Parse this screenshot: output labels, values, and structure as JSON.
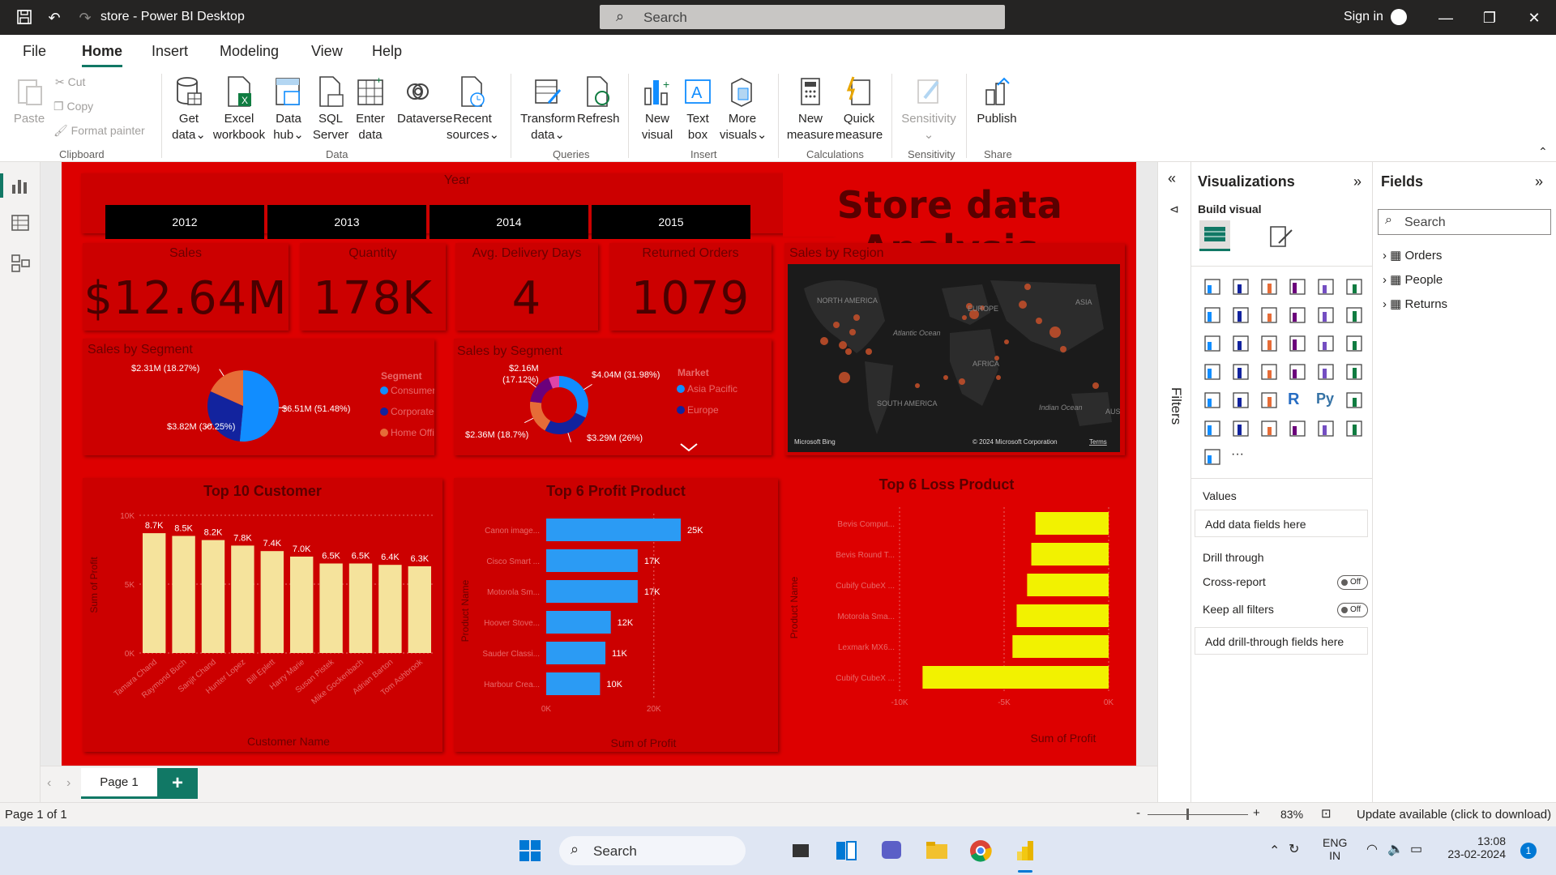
{
  "app": {
    "title": "store - Power BI Desktop",
    "search_placeholder": "Search",
    "signin": "Sign in"
  },
  "menu": {
    "tabs": [
      "File",
      "Home",
      "Insert",
      "Modeling",
      "View",
      "Help"
    ],
    "active": "Home"
  },
  "ribbon": {
    "paste": "Paste",
    "cut": "Cut",
    "copy": "Copy",
    "format_painter": "Format painter",
    "get_data": "Get data",
    "excel": "Excel workbook",
    "data_hub": "Data hub",
    "sql": "SQL Server",
    "enter_data": "Enter data",
    "dataverse": "Dataverse",
    "recent": "Recent sources",
    "transform": "Transform data",
    "refresh": "Refresh",
    "new_visual": "New visual",
    "text_box": "Text box",
    "more_visuals": "More visuals",
    "new_measure": "New measure",
    "quick_measure": "Quick measure",
    "sensitivity": "Sensitivity",
    "publish": "Publish",
    "groups": {
      "clipboard": "Clipboard",
      "data": "Data",
      "queries": "Queries",
      "insert": "Insert",
      "calculations": "Calculations",
      "sensitivity": "Sensitivity",
      "share": "Share"
    }
  },
  "report": {
    "year_slicer": {
      "title": "Year",
      "years": [
        "2012",
        "2013",
        "2014",
        "2015"
      ]
    },
    "main_title": "Store data Analysis",
    "kpis": [
      {
        "title": "Sales",
        "value": "$12.64M"
      },
      {
        "title": "Quantity",
        "value": "178K"
      },
      {
        "title": "Avg. Delivery Days",
        "value": "4"
      },
      {
        "title": "Returned Orders",
        "value": "1079"
      }
    ],
    "map": {
      "title": "Sales by Region",
      "credit": "Microsoft Bing",
      "copyright": "© 2024 Microsoft Corporation",
      "terms": "Terms",
      "labels": [
        "NORTH AMERICA",
        "EUROPE",
        "ASIA",
        "Atlantic Ocean",
        "AFRICA",
        "SOUTH AMERICA",
        "Indian Ocean",
        "AUST"
      ]
    }
  },
  "chart_data": [
    {
      "type": "pie",
      "title": "Sales by Segment",
      "legend_title": "Segment",
      "categories": [
        "Consumer",
        "Corporate",
        "Home Office"
      ],
      "values": [
        6.51,
        3.82,
        2.31
      ],
      "labels": [
        "$6.51M (51.48%)",
        "$3.82M (30.25%)",
        "$2.31M (18.27%)"
      ],
      "colors": [
        "#118dff",
        "#12239e",
        "#e66c37"
      ]
    },
    {
      "type": "pie",
      "title": "Sales by Segment",
      "legend_title": "Market",
      "categories": [
        "Asia Pacific",
        "Europe"
      ],
      "values": [
        4.04,
        3.29,
        2.36,
        2.16,
        0.75
      ],
      "labels": [
        "$4.04M (31.98%)",
        "$3.29M (26%)",
        "$2.36M (18.7%)",
        "$2.16M (17.12%)",
        ""
      ],
      "colors": [
        "#118dff",
        "#12239e",
        "#e66c37",
        "#6b007b",
        "#e044a7"
      ]
    },
    {
      "type": "bar",
      "title": "Top 10 Customer",
      "xlabel": "Customer Name",
      "ylabel": "Sum of Profit",
      "categories": [
        "Tamara Chand",
        "Raymond Buch",
        "Sanjit Chand",
        "Hunter Lopez",
        "Bill Eplett",
        "Harry Marie",
        "Susan Pistek",
        "Mike Gockenbach",
        "Adrian Barton",
        "Tom Ashbrook"
      ],
      "values": [
        8700,
        8500,
        8200,
        7800,
        7400,
        7000,
        6500,
        6500,
        6400,
        6300
      ],
      "data_labels": [
        "8.7K",
        "8.5K",
        "8.2K",
        "7.8K",
        "7.4K",
        "7.0K",
        "6.5K",
        "6.5K",
        "6.4K",
        "6.3K"
      ],
      "ylim": [
        0,
        10000
      ],
      "yticks": [
        "0K",
        "5K",
        "10K"
      ],
      "color": "#f5e39c"
    },
    {
      "type": "bar",
      "orientation": "horizontal",
      "title": "Top 6 Profit Product",
      "xlabel": "Sum of Profit",
      "ylabel": "Product Name",
      "categories": [
        "Canon image...",
        "Cisco Smart ...",
        "Motorola Sm...",
        "Hoover Stove...",
        "Sauder Classi...",
        "Harbour Crea..."
      ],
      "values": [
        25000,
        17000,
        17000,
        12000,
        11000,
        10000
      ],
      "data_labels": [
        "25K",
        "17K",
        "17K",
        "12K",
        "11K",
        "10K"
      ],
      "xlim": [
        0,
        25000
      ],
      "xticks": [
        "0K",
        "20K"
      ],
      "color": "#2b9bf4"
    },
    {
      "type": "bar",
      "orientation": "horizontal",
      "title": "Top 6 Loss Product",
      "xlabel": "Sum of Profit",
      "ylabel": "Product Name",
      "categories": [
        "Bevis Comput...",
        "Bevis Round T...",
        "Cubify CubeX ...",
        "Motorola Sma...",
        "Lexmark MX6...",
        "Cubify CubeX ..."
      ],
      "values": [
        -3500,
        -3700,
        -3900,
        -4400,
        -4600,
        -8900
      ],
      "xlim": [
        -10000,
        0
      ],
      "xticks": [
        "-10K",
        "-5K",
        "0K"
      ],
      "color": "#f2f200"
    }
  ],
  "filters_label": "Filters",
  "viz_pane": {
    "title": "Visualizations",
    "build_visual": "Build visual",
    "values": "Values",
    "add_data": "Add data fields here",
    "drill_through": "Drill through",
    "cross_report": "Cross-report",
    "keep_filters": "Keep all filters",
    "toggle_off": "Off",
    "add_drill": "Add drill-through fields here"
  },
  "fields_pane": {
    "title": "Fields",
    "search": "Search",
    "tables": [
      "Orders",
      "People",
      "Returns"
    ]
  },
  "page_tabs": {
    "page1": "Page 1"
  },
  "status": {
    "page": "Page 1 of 1",
    "zoom": "83%",
    "update": "Update available (click to download)"
  },
  "taskbar": {
    "search": "Search",
    "lang1": "ENG",
    "lang2": "IN",
    "time": "13:08",
    "date": "23-02-2024",
    "notif": "1"
  }
}
